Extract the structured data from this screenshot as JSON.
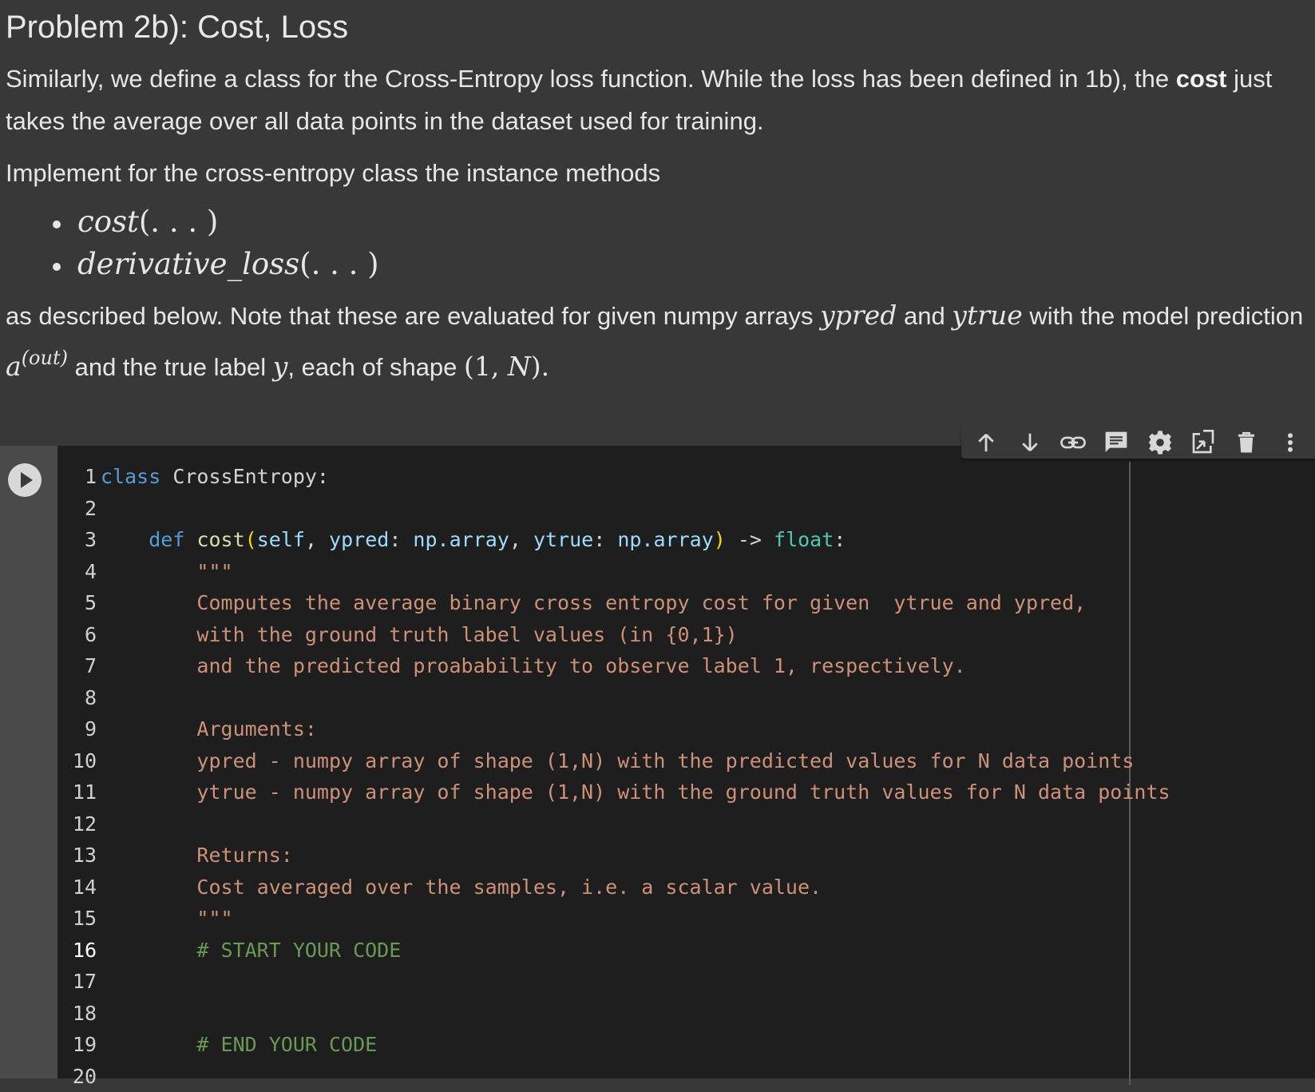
{
  "markdown": {
    "heading": "Problem 2b): Cost, Loss",
    "p1_text_a": "Similarly, we define a class for the Cross-Entropy loss function. While the loss has been defined in 1b), the ",
    "p1_bold": "cost",
    "p1_text_b": " just takes the average over all data points in the dataset used for training.",
    "p2_text": "Implement for the cross-entropy class the instance methods",
    "methods": [
      {
        "name": "cost",
        "args": "(. . . )"
      },
      {
        "name": "derivative_loss",
        "args": "(. . . )"
      }
    ],
    "p3_a": "as described below. Note that these are evaluated for given numpy arrays ",
    "p3_ypred": "ypred",
    "p3_b": " and ",
    "p3_ytrue": "ytrue",
    "p3_c": " with the model prediction ",
    "p3_a_sym": "a",
    "p3_a_sup": "(out)",
    "p3_d": " and the true label ",
    "p3_y": "y",
    "p3_e": ", each of shape ",
    "p3_shape_open": "(1, ",
    "p3_shape_n": "N",
    "p3_shape_close": ").",
    "p3_end": ""
  },
  "toolbar": {
    "icons": [
      "arrow-up-icon",
      "arrow-down-icon",
      "link-icon",
      "comment-icon",
      "gear-icon",
      "mirror-cell-icon",
      "trash-icon",
      "more-vert-icon"
    ]
  },
  "code": {
    "active_line": 16,
    "line_numbers": [
      "1",
      "2",
      "3",
      "4",
      "5",
      "6",
      "7",
      "8",
      "9",
      "10",
      "11",
      "12",
      "13",
      "14",
      "15",
      "16",
      "17",
      "18",
      "19",
      "20"
    ],
    "l1_kw": "class",
    "l1_name": " CrossEntropy:",
    "l3_indent": "    ",
    "l3_def": "def",
    "l3_fn": "cost",
    "l3_self": "self",
    "l3_p1": "ypred",
    "l3_t1": "np.array",
    "l3_p2": "ytrue",
    "l3_t2": "np.array",
    "l3_arrow": " -> ",
    "l3_ret": "float",
    "l4": "        \"\"\"",
    "l5": "        Computes the average binary cross entropy cost for given  ytrue and ypred,",
    "l6": "        with the ground truth label values (in {0,1})",
    "l7": "        and the predicted proabability to observe label 1, respectively.",
    "l9": "        Arguments:",
    "l10": "        ypred - numpy array of shape (1,N) with the predicted values for N data points",
    "l11": "        ytrue - numpy array of shape (1,N) with the ground truth values for N data points",
    "l13": "        Returns:",
    "l14": "        Cost averaged over the samples, i.e. a scalar value.",
    "l15": "        \"\"\"",
    "l16": "        # START YOUR CODE",
    "l19": "        # END YOUR CODE"
  }
}
